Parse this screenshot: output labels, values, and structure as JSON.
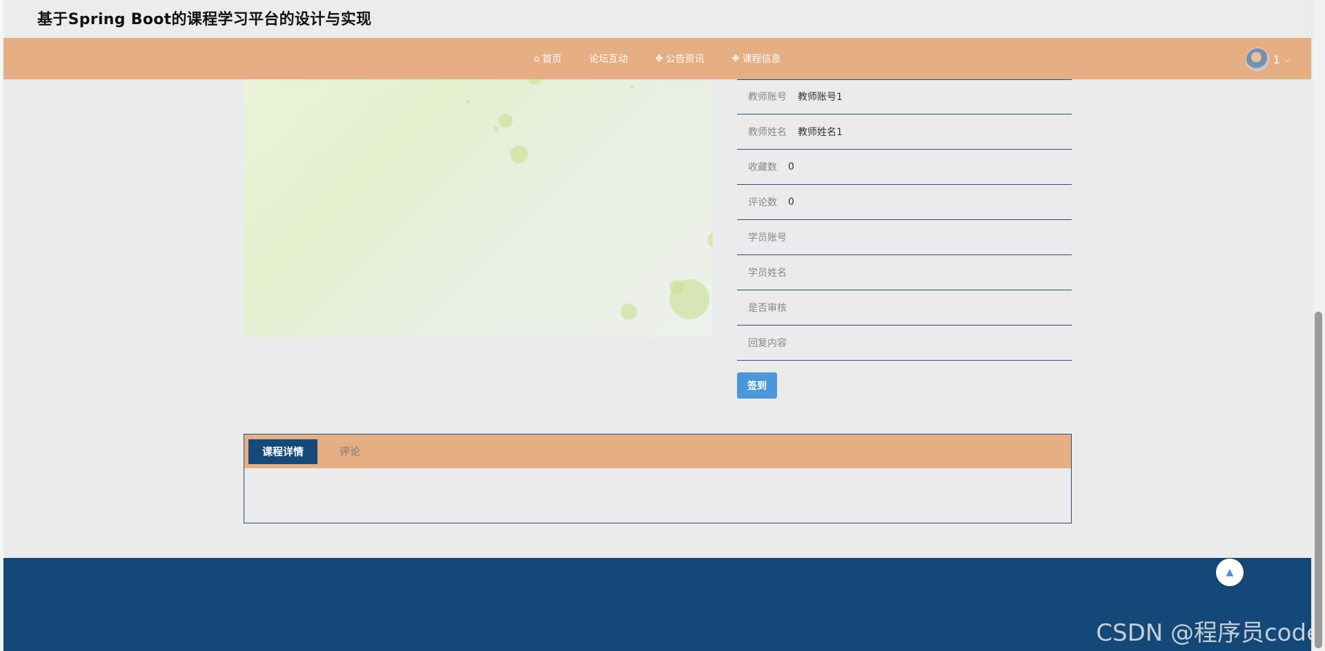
{
  "site": {
    "title": "基于Spring Boot的课程学习平台的设计与实现"
  },
  "nav": {
    "items": [
      {
        "label": "首页",
        "icon": "home-icon",
        "glyph": "⌂"
      },
      {
        "label": "论坛互动",
        "icon": "",
        "glyph": ""
      },
      {
        "label": "公告资讯",
        "icon": "grid-icon",
        "glyph": "✤"
      },
      {
        "label": "课程信息",
        "icon": "grid-icon",
        "glyph": "✤"
      }
    ],
    "user": {
      "name": "1",
      "chevron": "⌵"
    }
  },
  "details": {
    "rows": [
      {
        "label": "教师账号",
        "value": "教师账号1"
      },
      {
        "label": "教师姓名",
        "value": "教师姓名1"
      },
      {
        "label": "收藏数",
        "value": "0"
      },
      {
        "label": "评论数",
        "value": "0"
      },
      {
        "label": "学员账号",
        "value": ""
      },
      {
        "label": "学员姓名",
        "value": ""
      },
      {
        "label": "是否审核",
        "value": ""
      },
      {
        "label": "回复内容",
        "value": ""
      }
    ],
    "signin_label": "签到"
  },
  "tabs": [
    {
      "label": "课程详情",
      "active": true
    },
    {
      "label": "评论",
      "active": false
    }
  ],
  "footer": {
    "backtop_glyph": "▲"
  },
  "watermark": "CSDN @程序员code",
  "colors": {
    "nav": "#e5ae83",
    "footer": "#134878",
    "active_tab": "#15497a",
    "button": "#4a97db"
  }
}
